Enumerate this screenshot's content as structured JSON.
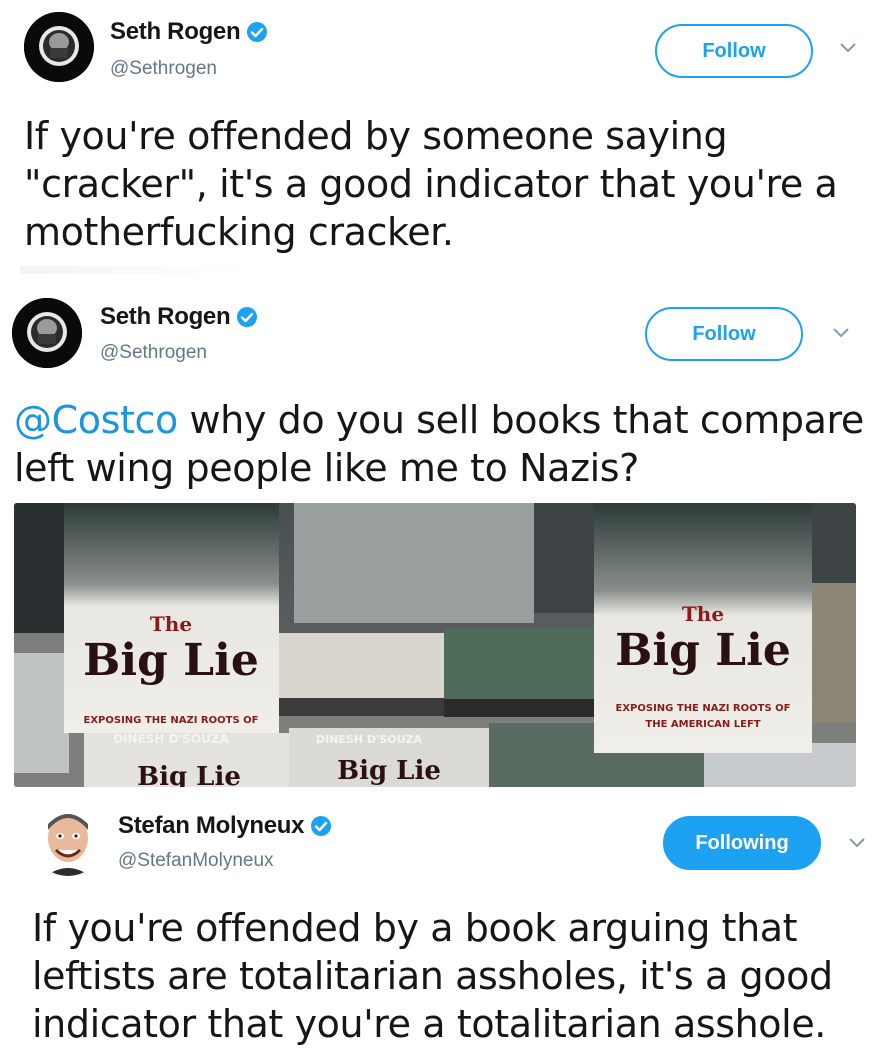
{
  "tweets": [
    {
      "display_name": "Seth Rogen",
      "handle": "@Sethrogen",
      "follow_label": "Follow",
      "text": "If you're offended by someone saying \"cracker\", it's a good indicator that you're a motherfucking cracker."
    },
    {
      "display_name": "Seth Rogen",
      "handle": "@Sethrogen",
      "follow_label": "Follow",
      "mention": "@Costco",
      "text_after_mention": " why do you sell books that compare left wing people like me to Nazis?",
      "media": {
        "book_title_small": "The",
        "book_title": "Big Lie",
        "book_subtitle_left": "EXPOSING THE NAZI ROOTS OF",
        "book_subtitle_right_1": "EXPOSING THE NAZI ROOTS OF",
        "book_subtitle_right_2": "THE AMERICAN LEFT",
        "author": "DINESH D'SOUZA"
      }
    },
    {
      "display_name": "Stefan Molyneux",
      "handle": "@StefanMolyneux",
      "follow_label": "Following",
      "text": "If you're offended by a book arguing that leftists are totalitarian assholes, it's a good indicator that you're a totalitarian asshole."
    }
  ],
  "colors": {
    "accent": "#1da1f2",
    "mention": "#1b95e0",
    "text": "#14171a",
    "muted": "#657786"
  }
}
